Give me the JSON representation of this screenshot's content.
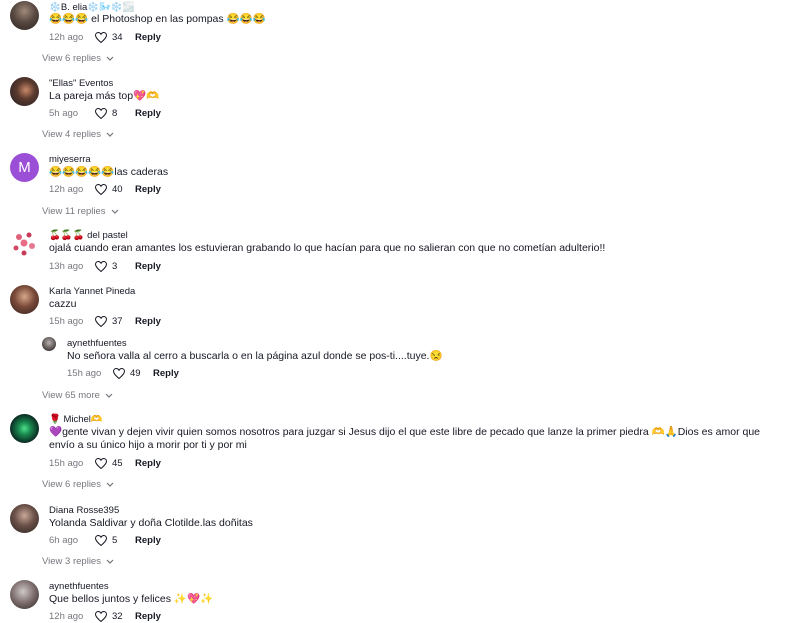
{
  "comments": [
    {
      "username": "❄️B. elia❄️🌬️❄️🌫️",
      "text": "😂😂😂 el Photoshop en las pompas 😂😂😂",
      "time": "12h ago",
      "likes": "34",
      "reply_label": "Reply",
      "view_replies": "View 6 replies"
    },
    {
      "username": "\"Ellas\" Eventos",
      "text": "La pareja más top💖🫶",
      "time": "5h ago",
      "likes": "8",
      "reply_label": "Reply",
      "view_replies": "View 4 replies"
    },
    {
      "username": "miyeserra",
      "avatar_letter": "M",
      "text": "😂😂😂😂😂las caderas",
      "time": "12h ago",
      "likes": "40",
      "reply_label": "Reply",
      "view_replies": "View 11 replies"
    },
    {
      "username": "🍒🍒🍒 del pastel",
      "text": "ojalá cuando eran amantes los estuvieran grabando lo que hacían para que no salieran con que no cometían adulterio!!",
      "time": "13h ago",
      "likes": "3",
      "reply_label": "Reply"
    },
    {
      "username": "Karla Yannet Pineda",
      "text": "cazzu",
      "time": "15h ago",
      "likes": "37",
      "reply_label": "Reply",
      "reply": {
        "username": "aynethfuentes",
        "text": "No señora valla al cerro a buscarla o en la página azul donde se pos-ti....tuye.😒",
        "time": "15h ago",
        "likes": "49",
        "reply_label": "Reply"
      },
      "view_replies": "View 65 more"
    },
    {
      "username": "🌹 Michel🫶",
      "text": "💜gente vivan y dejen vivir quien somos nosotros para juzgar si Jesus dijo el que este libre de pecado que lanze la primer piedra 🫶🙏Dios es amor que envío a su único hijo a morir por ti y por mi",
      "time": "15h ago",
      "likes": "45",
      "reply_label": "Reply",
      "view_replies": "View 6 replies"
    },
    {
      "username": "Diana Rosse395",
      "text": "Yolanda Saldivar y doña Clotilde.las doñitas",
      "time": "6h ago",
      "likes": "5",
      "reply_label": "Reply",
      "view_replies": "View 3 replies"
    },
    {
      "username": "aynethfuentes",
      "text": "Que bellos juntos y felices ✨💖✨",
      "time": "12h ago",
      "likes": "32",
      "reply_label": "Reply"
    }
  ],
  "colors": {
    "accent_purple": "#9b4fd6",
    "text": "#161823",
    "muted": "rgba(22,24,35,0.6)"
  }
}
